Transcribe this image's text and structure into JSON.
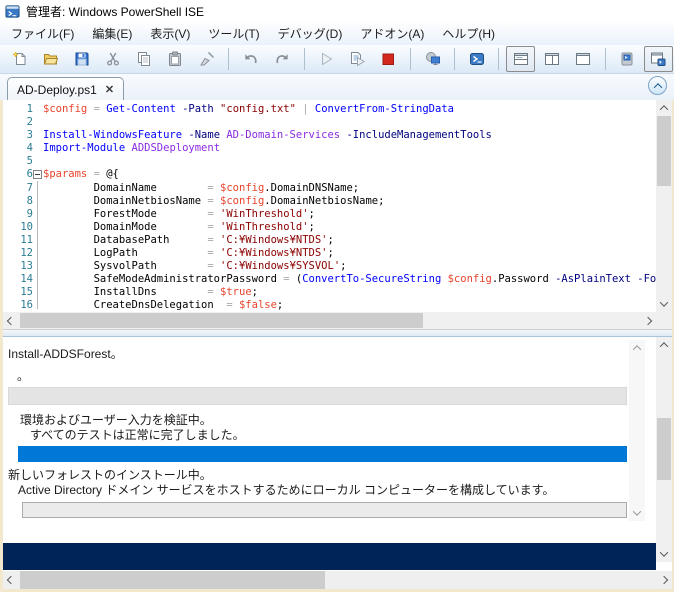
{
  "window": {
    "title": "管理者: Windows PowerShell ISE"
  },
  "colors": {
    "cmdlet": "#0000FF",
    "parameter": "#000080",
    "string": "#8B0000",
    "variable": "#E8442C",
    "argument": "#8A2BE2",
    "operator": "#A9A9A9",
    "plain": "#000000",
    "progress_blue": "#0078D7",
    "console_navy": "#012456",
    "stop_red": "#D2281E"
  },
  "menu": {
    "items": [
      "ファイル(F)",
      "編集(E)",
      "表示(V)",
      "ツール(T)",
      "デバッグ(D)",
      "アドオン(A)",
      "ヘルプ(H)"
    ]
  },
  "toolbar": {
    "buttons": [
      {
        "name": "new-script"
      },
      {
        "name": "open-script"
      },
      {
        "name": "save-script"
      },
      {
        "name": "cut"
      },
      {
        "name": "copy"
      },
      {
        "name": "paste"
      },
      {
        "name": "clear-console-pane"
      },
      {
        "sep": true
      },
      {
        "name": "undo"
      },
      {
        "name": "redo"
      },
      {
        "sep": true
      },
      {
        "name": "run-script",
        "disabled": true
      },
      {
        "name": "run-selection"
      },
      {
        "name": "stop-operation"
      },
      {
        "sep": true
      },
      {
        "name": "new-remote-powershell-tab"
      },
      {
        "sep": true
      },
      {
        "name": "start-powershell"
      },
      {
        "sep": true
      },
      {
        "name": "show-script-pane-top",
        "pressed": true
      },
      {
        "name": "show-script-pane-right"
      },
      {
        "name": "show-script-pane-maximized"
      },
      {
        "sep": true
      },
      {
        "name": "new-powershell-tab"
      },
      {
        "name": "show-command-window",
        "pressed": true
      }
    ]
  },
  "editor": {
    "tab_label": "AD-Deploy.ps1",
    "tab_close": "✕",
    "lines": [
      {
        "n": 1,
        "segs": [
          [
            "v",
            "$config"
          ],
          [
            "o",
            " = "
          ],
          [
            "c",
            "Get-Content"
          ],
          [
            "t",
            " "
          ],
          [
            "p",
            "-Path"
          ],
          [
            "t",
            " "
          ],
          [
            "s",
            "\"config.txt\""
          ],
          [
            "t",
            " "
          ],
          [
            "o",
            "|"
          ],
          [
            "t",
            " "
          ],
          [
            "c",
            "ConvertFrom-StringData"
          ]
        ]
      },
      {
        "n": 2,
        "segs": []
      },
      {
        "n": 3,
        "segs": [
          [
            "c",
            "Install-WindowsFeature"
          ],
          [
            "t",
            " "
          ],
          [
            "p",
            "-Name"
          ],
          [
            "t",
            " "
          ],
          [
            "a",
            "AD-Domain-Services"
          ],
          [
            "t",
            " "
          ],
          [
            "p",
            "-IncludeManagementTools"
          ]
        ]
      },
      {
        "n": 4,
        "segs": [
          [
            "c",
            "Import-Module"
          ],
          [
            "t",
            " "
          ],
          [
            "a",
            "ADDSDeployment"
          ]
        ]
      },
      {
        "n": 5,
        "segs": []
      },
      {
        "n": 6,
        "segs": [
          [
            "v",
            "$params"
          ],
          [
            "o",
            " = "
          ],
          [
            "t",
            "@{"
          ]
        ],
        "fold": "open"
      },
      {
        "n": 7,
        "segs": [
          [
            "t",
            "        DomainName        "
          ],
          [
            "o",
            "= "
          ],
          [
            "v",
            "$config"
          ],
          [
            "t",
            ".DomainDNSName;"
          ]
        ]
      },
      {
        "n": 8,
        "segs": [
          [
            "t",
            "        DomainNetbiosName "
          ],
          [
            "o",
            "= "
          ],
          [
            "v",
            "$config"
          ],
          [
            "t",
            ".DomainNetbiosName;"
          ]
        ]
      },
      {
        "n": 9,
        "segs": [
          [
            "t",
            "        ForestMode        "
          ],
          [
            "o",
            "= "
          ],
          [
            "s",
            "'WinThreshold'"
          ],
          [
            "t",
            ";"
          ]
        ]
      },
      {
        "n": 10,
        "segs": [
          [
            "t",
            "        DomainMode        "
          ],
          [
            "o",
            "= "
          ],
          [
            "s",
            "'WinThreshold'"
          ],
          [
            "t",
            ";"
          ]
        ]
      },
      {
        "n": 11,
        "segs": [
          [
            "t",
            "        DatabasePath      "
          ],
          [
            "o",
            "= "
          ],
          [
            "s",
            "'C:¥Windows¥NTDS'"
          ],
          [
            "t",
            ";"
          ]
        ]
      },
      {
        "n": 12,
        "segs": [
          [
            "t",
            "        LogPath           "
          ],
          [
            "o",
            "= "
          ],
          [
            "s",
            "'C:¥Windows¥NTDS'"
          ],
          [
            "t",
            ";"
          ]
        ]
      },
      {
        "n": 13,
        "segs": [
          [
            "t",
            "        SysvolPath        "
          ],
          [
            "o",
            "= "
          ],
          [
            "s",
            "'C:¥Windows¥SYSVOL'"
          ],
          [
            "t",
            ";"
          ]
        ]
      },
      {
        "n": 14,
        "segs": [
          [
            "t",
            "        SafeModeAdministratorPassword "
          ],
          [
            "o",
            "= "
          ],
          [
            "t",
            "("
          ],
          [
            "c",
            "ConvertTo-SecureString"
          ],
          [
            "t",
            " "
          ],
          [
            "v",
            "$config"
          ],
          [
            "t",
            ".Password "
          ],
          [
            "p",
            "-AsPlainText"
          ],
          [
            "t",
            " "
          ],
          [
            "p",
            "-Force"
          ],
          [
            "t",
            ");"
          ]
        ]
      },
      {
        "n": 15,
        "segs": [
          [
            "t",
            "        InstallDns        "
          ],
          [
            "o",
            "= "
          ],
          [
            "v",
            "$true"
          ],
          [
            "t",
            ";"
          ]
        ]
      },
      {
        "n": 16,
        "segs": [
          [
            "t",
            "        CreateDnsDelegation  "
          ],
          [
            "o",
            "= "
          ],
          [
            "v",
            "$false"
          ],
          [
            "t",
            ";"
          ]
        ]
      }
    ]
  },
  "console": {
    "progress": [
      {
        "activity": "Install-ADDSForest。",
        "status": "。",
        "bar": "empty"
      },
      {
        "activity": "環境およびユーザー入力を検証中。",
        "status": "すべてのテストは正常に完了しました。",
        "bar": "full"
      },
      {
        "activity": "新しいフォレストのインストール中。",
        "status": "Active Directory ドメイン サービスをホストするためにローカル コンピューターを構成しています。",
        "bar": "empty"
      }
    ]
  }
}
